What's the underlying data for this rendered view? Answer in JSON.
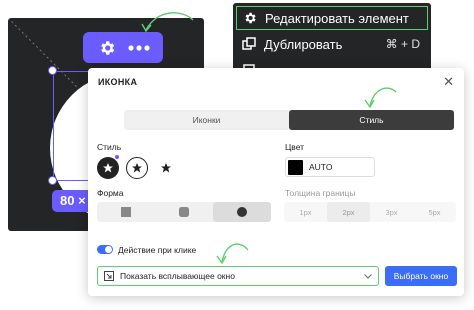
{
  "canvas": {
    "size_label": "80 ×"
  },
  "context_menu": {
    "items": [
      {
        "label": "Редактировать элемент",
        "shortcut": "",
        "icon": "gear-icon"
      },
      {
        "label": "Дублировать",
        "shortcut": "⌘ + D",
        "icon": "duplicate-icon"
      },
      {
        "label": "",
        "shortcut": "",
        "icon": "partial-icon"
      }
    ]
  },
  "panel": {
    "title": "ИКОНКА",
    "tabs": [
      {
        "label": "Иконки",
        "active": false
      },
      {
        "label": "Стиль",
        "active": true
      }
    ],
    "style_label": "Стиль",
    "color_label": "Цвет",
    "color_value": "AUTO",
    "shape_label": "Форма",
    "border_label": "Толщина границы",
    "border_options": [
      "1px",
      "2px",
      "3px",
      "5px"
    ],
    "border_selected": "2px",
    "toggle_label": "Действие при клике",
    "toggle_on": true,
    "action_select": "Показать всплывающее окно",
    "action_button": "Выбрать окно"
  },
  "colors": {
    "accent": "#6a5cff",
    "highlight": "#5fce6e",
    "primary": "#3b6df6",
    "dark": "#242527"
  }
}
